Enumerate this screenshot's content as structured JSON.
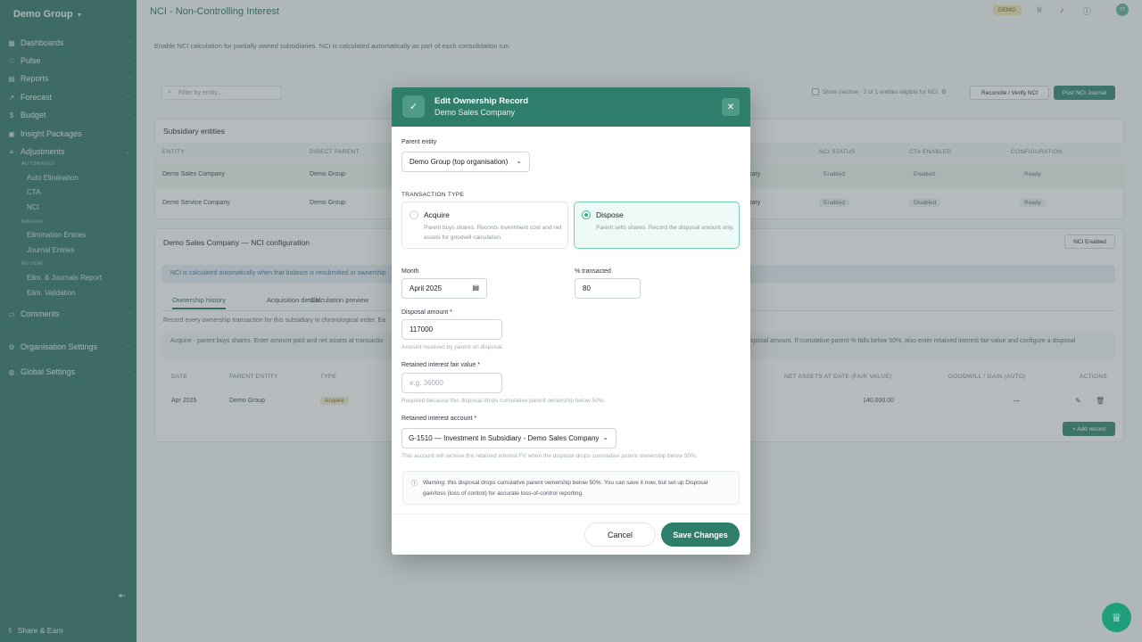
{
  "sidebar": {
    "org_name": "Demo Group",
    "items": [
      {
        "label": "Dashboards",
        "icon": "grid-icon"
      },
      {
        "label": "Pulse",
        "icon": "heart-icon"
      },
      {
        "label": "Reports",
        "icon": "chart-icon"
      },
      {
        "label": "Forecast",
        "icon": "trend-icon"
      },
      {
        "label": "Budget",
        "icon": "dollar-icon"
      },
      {
        "label": "Insight Packages",
        "icon": "package-icon"
      },
      {
        "label": "Adjustments",
        "icon": "sliders-icon"
      },
      {
        "label": "Comments",
        "icon": "comment-icon"
      },
      {
        "label": "Organisation Settings",
        "icon": "gear-icon"
      },
      {
        "label": "Global Settings",
        "icon": "globe-icon"
      }
    ],
    "groups": {
      "automated": "AUTOMATED",
      "manual": "MANUAL",
      "review": "REVIEW"
    },
    "sub_items": {
      "auto_elimination": "Auto Elimination",
      "cta": "CTA",
      "nci": "NCI",
      "elimination_entries": "Elimination Entries",
      "journal_entries": "Journal Entries",
      "elim_journals_report": "Elim. & Journals Report",
      "elim_validation": "Elim. Validation"
    },
    "share": "Share & Earn"
  },
  "header": {
    "title": "NCI - Non-Controlling Interest",
    "demo_badge": "DEMO",
    "avatar": "TT"
  },
  "main": {
    "intro": "Enable NCI calculation for partially owned subsidiaries. NCI is calculated automatically as part of each consolidation run.",
    "search_placeholder": "Filter by entity...",
    "show_inactive": "Show inactive · 2 of 1 entities eligible for NCI",
    "reconcile_button": "Reconcile / Verify NCI",
    "post_button": "Post NCI Journal",
    "subsidiary_title": "Subsidiary entities",
    "sub_headers": {
      "entity": "ENTITY",
      "direct_parent": "DIRECT PARENT",
      "nci_status": "NCI STATUS",
      "cta_enabled": "CTA ENABLED",
      "configuration": "CONFIGURATION"
    },
    "sub_rows": [
      {
        "entity": "Demo Sales Company",
        "parent": "Demo Group",
        "frag": "iary",
        "nci": "Enabled",
        "cta": "Enabled",
        "config": "Ready"
      },
      {
        "entity": "Demo Service Company",
        "parent": "Demo Group",
        "frag": "iary",
        "nci": "Enabled",
        "cta": "Disabled",
        "config": "Ready"
      }
    ],
    "config_title": "Demo Sales Company — NCI configuration",
    "nci_enabled_btn": "NCI Enabled",
    "info_text": "NCI is calculated automatically when that balance is resubmitted or ownership",
    "tabs": [
      "Ownership history",
      "Acquisition details",
      "Calculation preview"
    ],
    "record_text": "Record every ownership transaction for this subsidiary in chronological order. Ea",
    "hint_left": "Acquire - parent buys shares. Enter amount paid and net assets at transactio",
    "hint_right": "sposal amount. If cumulative parent % falls below 50%, also enter retained interest fair value and configure a disposal",
    "hist_headers": {
      "date": "DATE",
      "parent_entity": "PARENT ENTITY",
      "type": "TYPE",
      "net_assets": "NET ASSETS AT DATE (FAIR VALUE)",
      "goodwill": "GOODWILL / GAIN (AUTO)",
      "actions": "ACTIONS"
    },
    "hist_row": {
      "date": "Apr 2025",
      "parent": "Demo Group",
      "type": "Acquire",
      "net_assets": "140,000.00",
      "goodwill": "—"
    },
    "add_record": "+ Add record"
  },
  "modal": {
    "title": "Edit Ownership Record",
    "subtitle": "Demo Sales Company",
    "parent_entity_label": "Parent entity",
    "parent_entity_value": "Demo Group (top organisation)",
    "transaction_type_label": "TRANSACTION TYPE",
    "acquire": {
      "title": "Acquire",
      "desc": "Parent buys shares. Records investment cost and net assets for goodwill calculation."
    },
    "dispose": {
      "title": "Dispose",
      "desc": "Parent sells shares. Record the disposal amount only."
    },
    "selected_type": "dispose",
    "month_label": "Month",
    "month_value": "April 2025",
    "pct_label": "% transacted",
    "pct_value": "80",
    "disposal_label": "Disposal amount *",
    "disposal_value": "117000",
    "disposal_help": "Amount received by parent on disposal.",
    "retained_fv_label": "Retained interest fair value *",
    "retained_fv_placeholder": "e.g. 36000",
    "retained_fv_help": "Required because this disposal drops cumulative parent ownership below 50%.",
    "retained_acct_label": "Retained interest account *",
    "retained_acct_value": "G-1510 — Investment in Subsidiary - Demo Sales Company",
    "retained_acct_help": "This account will receive the retained interest FV when the disposal drops cumulative parent ownership below 50%.",
    "warning": "Warning: this disposal drops cumulative parent ownership below 50%. You can save it now, but set up Disposal gain/loss (loss of control) for accurate loss-of-control reporting.",
    "cancel": "Cancel",
    "save": "Save Changes"
  }
}
